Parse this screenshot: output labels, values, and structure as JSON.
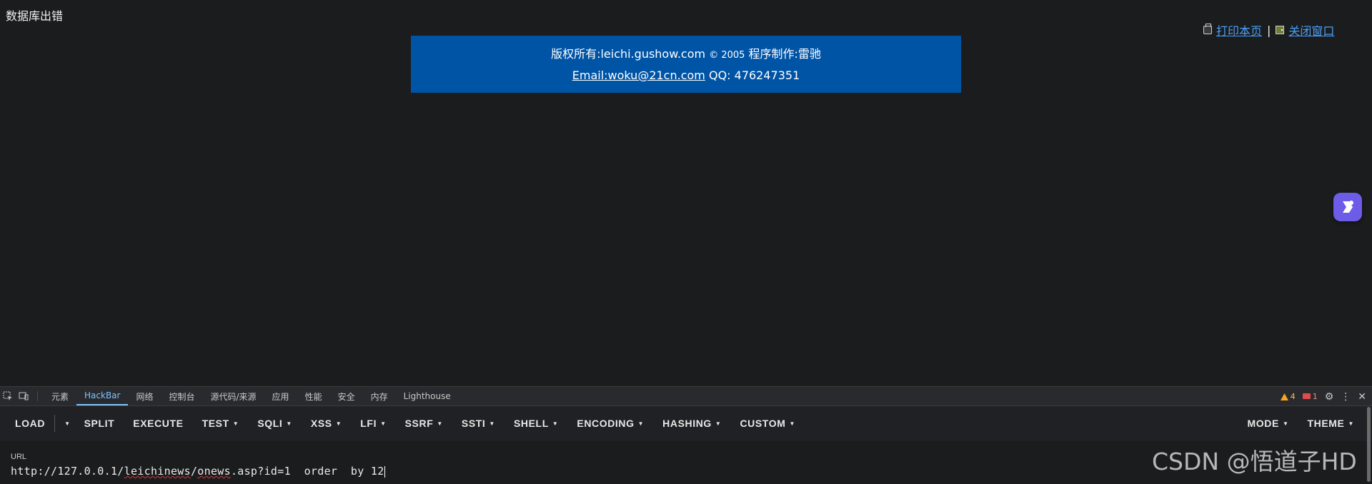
{
  "page": {
    "error_text": "数据库出错",
    "print_link": "打印本页",
    "separator": "|",
    "close_link": "关闭窗口",
    "banner": {
      "line1_prefix": "版权所有:leichi.gushow.com",
      "line1_copy": "© 2005",
      "line1_suffix": "程序制作:雷驰",
      "email": "Email:woku@21cn.com",
      "qq": "QQ: 476247351"
    },
    "float_button_icon": "assistant-icon"
  },
  "devtools": {
    "tabs": [
      "元素",
      "HackBar",
      "网络",
      "控制台",
      "源代码/来源",
      "应用",
      "性能",
      "安全",
      "内存",
      "Lighthouse"
    ],
    "active_tab": "HackBar",
    "warnings": "4",
    "errors": "1"
  },
  "hackbar": {
    "buttons": [
      {
        "label": "LOAD",
        "caret": false
      },
      {
        "label": "SPLIT",
        "caret": false
      },
      {
        "label": "EXECUTE",
        "caret": false
      },
      {
        "label": "TEST",
        "caret": true
      },
      {
        "label": "SQLI",
        "caret": true
      },
      {
        "label": "XSS",
        "caret": true
      },
      {
        "label": "LFI",
        "caret": true
      },
      {
        "label": "SSRF",
        "caret": true
      },
      {
        "label": "SSTI",
        "caret": true
      },
      {
        "label": "SHELL",
        "caret": true
      },
      {
        "label": "ENCODING",
        "caret": true
      },
      {
        "label": "HASHING",
        "caret": true
      },
      {
        "label": "CUSTOM",
        "caret": true
      }
    ],
    "right_buttons": [
      {
        "label": "MODE",
        "caret": true
      },
      {
        "label": "THEME",
        "caret": true
      }
    ],
    "url_label": "URL",
    "url_part1": "http://127.0.0.1/",
    "url_part2": "leichinews",
    "url_part3": "/",
    "url_part4": "onews",
    "url_part5": ".asp?id=1  order  by 12"
  },
  "watermark": "CSDN @悟道子HD"
}
